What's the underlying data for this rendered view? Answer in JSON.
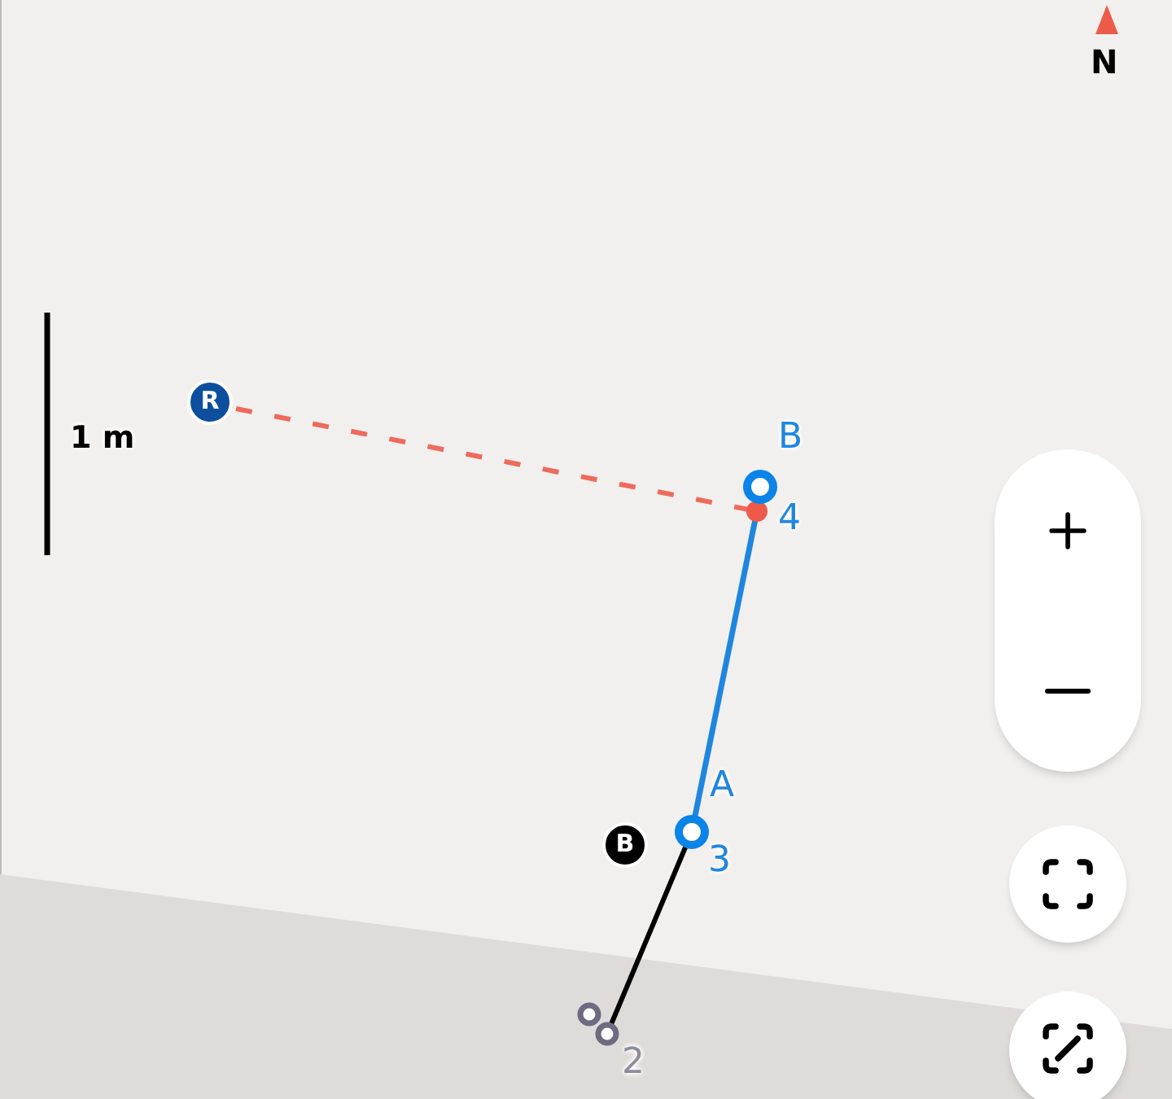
{
  "compass": {
    "label": "N"
  },
  "scale_bar": {
    "label": "1 m"
  },
  "markers": [
    {
      "letter": "R",
      "kind": "reference"
    },
    {
      "letter": "B",
      "kind": "base"
    }
  ],
  "points": [
    {
      "name": "B",
      "number": "4",
      "kind": "active"
    },
    {
      "name": "A",
      "number": "3",
      "kind": "active"
    },
    {
      "number": "2",
      "kind": "inactive"
    }
  ]
}
